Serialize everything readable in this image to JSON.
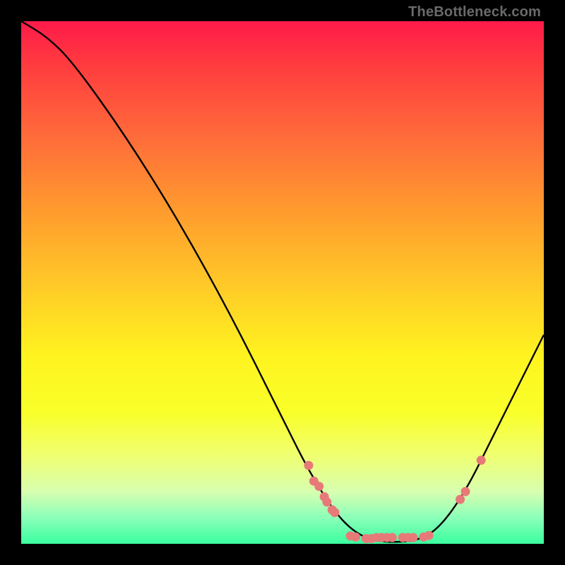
{
  "attribution": "TheBottleneck.com",
  "colors": {
    "page_bg": "#000000",
    "curve": "#000000",
    "dot": "#e77a78",
    "attribution_text": "#6a6a6a"
  },
  "chart_data": {
    "type": "line",
    "title": "",
    "xlabel": "",
    "ylabel": "",
    "xlim": [
      0,
      100
    ],
    "ylim": [
      0,
      100
    ],
    "grid": false,
    "legend": false,
    "curve": [
      {
        "x": 0,
        "y": 100
      },
      {
        "x": 5,
        "y": 97
      },
      {
        "x": 10,
        "y": 92
      },
      {
        "x": 20,
        "y": 78
      },
      {
        "x": 30,
        "y": 62
      },
      {
        "x": 40,
        "y": 44
      },
      {
        "x": 50,
        "y": 24
      },
      {
        "x": 55,
        "y": 14
      },
      {
        "x": 60,
        "y": 6
      },
      {
        "x": 64,
        "y": 2
      },
      {
        "x": 68,
        "y": 0.5
      },
      {
        "x": 72,
        "y": 0.3
      },
      {
        "x": 76,
        "y": 0.7
      },
      {
        "x": 80,
        "y": 3
      },
      {
        "x": 85,
        "y": 10
      },
      {
        "x": 90,
        "y": 20
      },
      {
        "x": 95,
        "y": 30
      },
      {
        "x": 100,
        "y": 40
      }
    ],
    "dots": [
      {
        "x": 55,
        "y": 15
      },
      {
        "x": 56,
        "y": 12
      },
      {
        "x": 57,
        "y": 11
      },
      {
        "x": 58,
        "y": 9
      },
      {
        "x": 58.5,
        "y": 8
      },
      {
        "x": 59.5,
        "y": 6.5
      },
      {
        "x": 60,
        "y": 6
      },
      {
        "x": 63,
        "y": 1.5
      },
      {
        "x": 64,
        "y": 1.3
      },
      {
        "x": 66,
        "y": 1.0
      },
      {
        "x": 67,
        "y": 1.0
      },
      {
        "x": 68,
        "y": 1.2
      },
      {
        "x": 69,
        "y": 1.2
      },
      {
        "x": 70,
        "y": 1.2
      },
      {
        "x": 71,
        "y": 1.2
      },
      {
        "x": 73,
        "y": 1.2
      },
      {
        "x": 74,
        "y": 1.2
      },
      {
        "x": 75,
        "y": 1.2
      },
      {
        "x": 77,
        "y": 1.3
      },
      {
        "x": 78,
        "y": 1.6
      },
      {
        "x": 84,
        "y": 8.5
      },
      {
        "x": 85,
        "y": 10
      },
      {
        "x": 88,
        "y": 16
      }
    ]
  }
}
